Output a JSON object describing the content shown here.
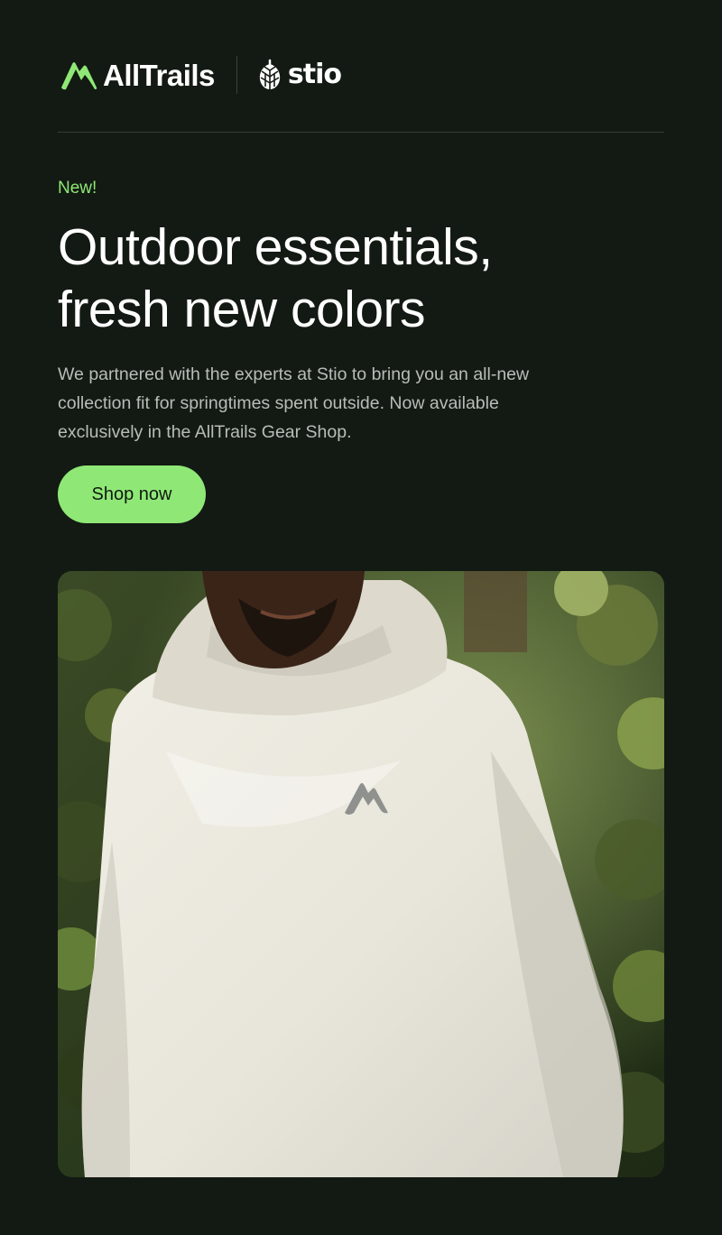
{
  "brand": {
    "partner_primary": "AllTrails",
    "partner_secondary": "stio",
    "accent_color": "#8fe876",
    "background_color": "#131a13"
  },
  "hero": {
    "eyebrow": "New!",
    "headline_lines": [
      "Outdoor essentials,",
      "fresh new colors"
    ],
    "body_lines": [
      "We partnered with the experts at Stio to bring you an all-new",
      "collection fit for springtimes spent outside. Now available",
      "exclusively in the AllTrails Gear Shop."
    ],
    "cta_label": "Shop now",
    "image_icon": "product-photo-hoodie"
  }
}
